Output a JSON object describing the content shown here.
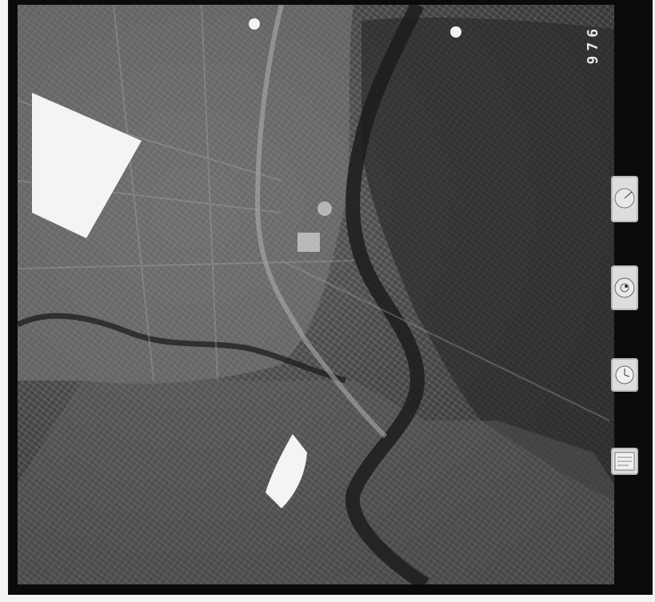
{
  "frame": {
    "frame_number": "976",
    "instruments": {
      "altimeter": {
        "icon": "altimeter-gauge-icon"
      },
      "level": {
        "icon": "bubble-level-icon"
      },
      "clock": {
        "icon": "clock-icon"
      },
      "label": {
        "icon": "date-label-icon"
      }
    }
  },
  "colors": {
    "film_border": "#0b0b0b",
    "paper": "#f3f3f3",
    "river": "#1f1f1f",
    "urban": "#8a8a8a",
    "hills": "#2d2d2d"
  }
}
